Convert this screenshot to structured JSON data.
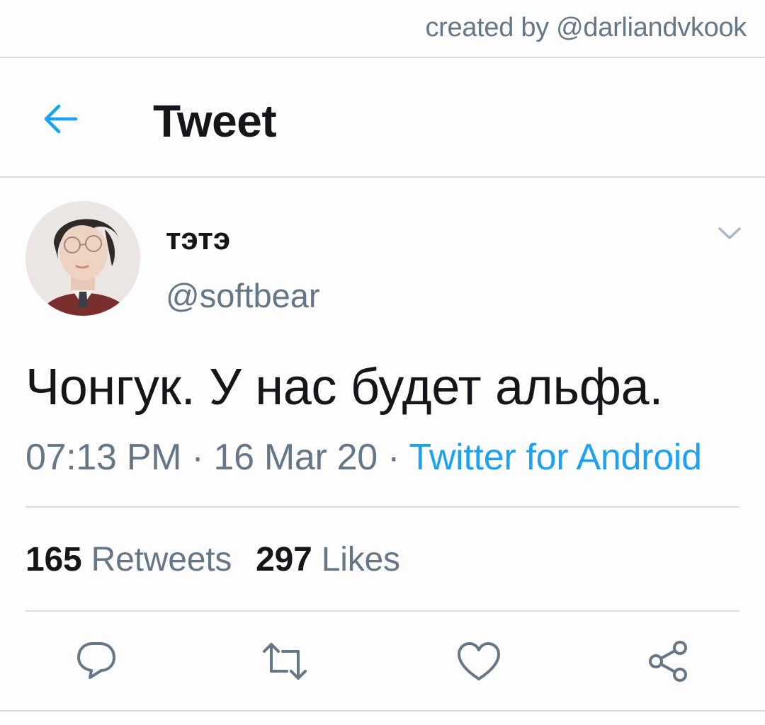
{
  "watermark": "created by @darliandvkook",
  "header": {
    "title": "Tweet",
    "back_icon": "arrow-left-icon"
  },
  "tweet": {
    "display_name": "тэтэ",
    "handle": "@softbear",
    "text": "Чонгук. У нас будет альфа.",
    "time": "07:13 PM",
    "separator": " · ",
    "date": "16 Mar 20",
    "source": "Twitter for Android"
  },
  "stats": {
    "retweets_count": "165",
    "retweets_label": "Retweets",
    "likes_count": "297",
    "likes_label": "Likes"
  },
  "actions": [
    "reply-icon",
    "retweet-icon",
    "like-icon",
    "share-icon"
  ],
  "colors": {
    "accent": "#1da1f2",
    "muted": "#657786",
    "text": "#14171a",
    "divider": "#d9dde1"
  }
}
